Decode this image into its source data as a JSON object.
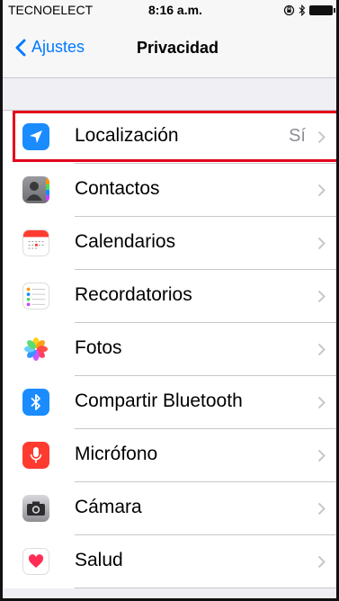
{
  "status_bar": {
    "carrier": "TECNOELECT",
    "time": "8:16 a.m."
  },
  "nav": {
    "back_label": "Ajustes",
    "title": "Privacidad"
  },
  "rows": [
    {
      "label": "Localización",
      "value": "Sí",
      "icon": "location-arrow-icon",
      "color": "#1a8cff"
    },
    {
      "label": "Contactos",
      "value": "",
      "icon": "contacts-icon",
      "color": "#8e8e93"
    },
    {
      "label": "Calendarios",
      "value": "",
      "icon": "calendar-icon",
      "color": "#ff3b30"
    },
    {
      "label": "Recordatorios",
      "value": "",
      "icon": "reminders-icon",
      "color": "#ffffff"
    },
    {
      "label": "Fotos",
      "value": "",
      "icon": "photos-icon",
      "color": "#ffffff"
    },
    {
      "label": "Compartir Bluetooth",
      "value": "",
      "icon": "bluetooth-icon",
      "color": "#1a8cff"
    },
    {
      "label": "Micrófono",
      "value": "",
      "icon": "microphone-icon",
      "color": "#ff3b30"
    },
    {
      "label": "Cámara",
      "value": "",
      "icon": "camera-icon",
      "color": "#8e8e93"
    },
    {
      "label": "Salud",
      "value": "",
      "icon": "health-heart-icon",
      "color": "#ffffff"
    }
  ],
  "colors": {
    "accent": "#007aff",
    "highlight_border": "#e3001b",
    "background": "#efeff4"
  }
}
